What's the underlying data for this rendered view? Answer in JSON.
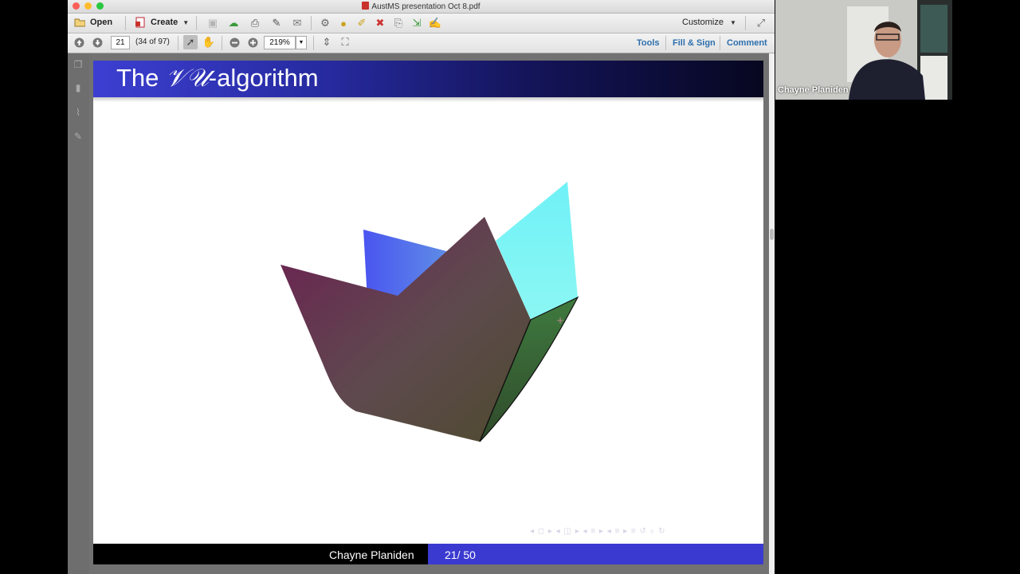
{
  "window": {
    "title": "AustMS presentation Oct 8.pdf"
  },
  "toolbar": {
    "open_label": "Open",
    "create_label": "Create",
    "customize_label": "Customize"
  },
  "nav": {
    "page_number": "21",
    "page_count_text": "(34 of 97)",
    "zoom_value": "219%"
  },
  "panels": {
    "tools_label": "Tools",
    "fill_sign_label": "Fill & Sign",
    "comment_label": "Comment"
  },
  "slide": {
    "title_prefix": "The ",
    "title_symbol": "𝒱𝒰",
    "title_suffix": "-algorithm",
    "footer_author": "Chayne Planiden",
    "footer_page": "21/ 50",
    "nav_symbols": "◂ ◻ ▸   ◂ ◫ ▸   ◂ ≡ ▸   ◂ ≡ ▸     ≡     ↺ ⌕ ↻",
    "colors": {
      "header_start": "#3c3fd1",
      "header_end": "#070720",
      "footer_right": "#3a3ad0"
    }
  },
  "webcam": {
    "name": "Chayne Planiden"
  }
}
